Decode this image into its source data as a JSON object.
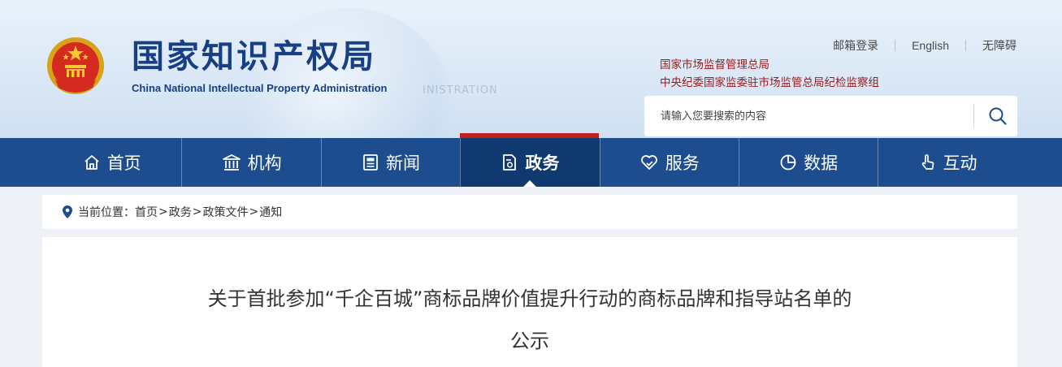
{
  "header": {
    "title_cn": "国家知识产权局",
    "title_en": "China National Intellectual Property Administration",
    "watermark": "INISTRATION",
    "top_links": [
      "邮箱登录",
      "English",
      "无障碍"
    ],
    "orgs": [
      "国家市场监督管理总局",
      "中央纪委国家监委驻市场监管总局纪检监察组"
    ],
    "search": {
      "placeholder": "请输入您要搜索的内容",
      "icon": "search-icon"
    }
  },
  "nav": {
    "active_index": 3,
    "items": [
      {
        "label": "首页",
        "icon": "home-icon"
      },
      {
        "label": "机构",
        "icon": "institution-icon"
      },
      {
        "label": "新闻",
        "icon": "news-icon"
      },
      {
        "label": "政务",
        "icon": "document-icon"
      },
      {
        "label": "服务",
        "icon": "heart-hand-icon"
      },
      {
        "label": "数据",
        "icon": "pie-chart-icon"
      },
      {
        "label": "互动",
        "icon": "hand-pointer-icon"
      }
    ]
  },
  "breadcrumb": {
    "prefix": "当前位置：",
    "items": [
      "首页",
      "政务",
      "政策文件",
      "通知"
    ],
    "separator": ">"
  },
  "article": {
    "title_line1": "关于首批参加“千企百城”商标品牌价值提升行动的商标品牌和指导站名单的",
    "title_line2": "公示"
  },
  "colors": {
    "nav_bg": "#1d4d8f",
    "nav_active_bg": "#10396f",
    "accent_red": "#c02020",
    "brand_blue": "#163f85",
    "org_red": "#9b1a1a"
  }
}
